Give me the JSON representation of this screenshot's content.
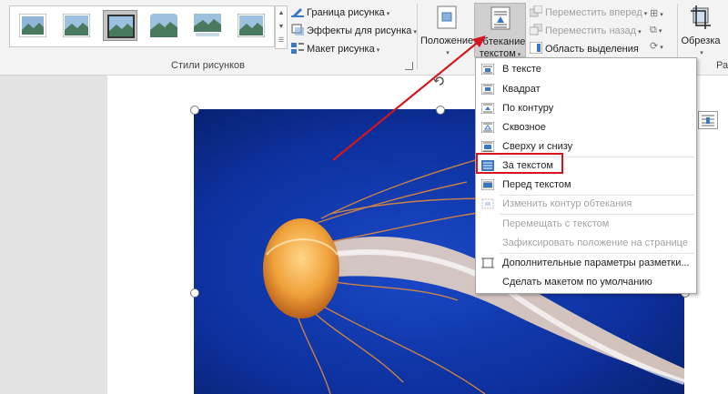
{
  "ribbon": {
    "gallery_label": "Стили рисунков",
    "picture_border": "Граница рисунка",
    "picture_effects": "Эффекты для рисунка",
    "picture_layout": "Макет рисунка",
    "position": "Положение",
    "wrap_text_line1": "Обтекание",
    "wrap_text_line2": "текстом",
    "bring_forward": "Переместить вперед",
    "send_backward": "Переместить назад",
    "selection_pane": "Область выделения",
    "crop": "Обрезка",
    "size_label_partial": "Раз"
  },
  "wrap_menu": {
    "items": [
      {
        "label": "В тексте",
        "enabled": true
      },
      {
        "label": "Квадрат",
        "enabled": true
      },
      {
        "label": "По контуру",
        "enabled": true
      },
      {
        "label": "Сквозное",
        "enabled": true
      },
      {
        "label": "Сверху и снизу",
        "enabled": true
      },
      {
        "label": "За текстом",
        "enabled": true,
        "highlighted": true
      },
      {
        "label": "Перед текстом",
        "enabled": true
      },
      {
        "label": "Изменить контур обтекания",
        "enabled": false
      },
      {
        "label": "Перемещать с текстом",
        "enabled": false
      },
      {
        "label": "Зафиксировать положение на странице",
        "enabled": false
      },
      {
        "label": "Дополнительные параметры разметки...",
        "enabled": true
      },
      {
        "label": "Сделать макетом по умолчанию",
        "enabled": true
      }
    ]
  },
  "colors": {
    "highlight_red": "#d5161e",
    "ribbon_bg": "#f3f3f3",
    "photo_blue": "#0a2f9c"
  }
}
